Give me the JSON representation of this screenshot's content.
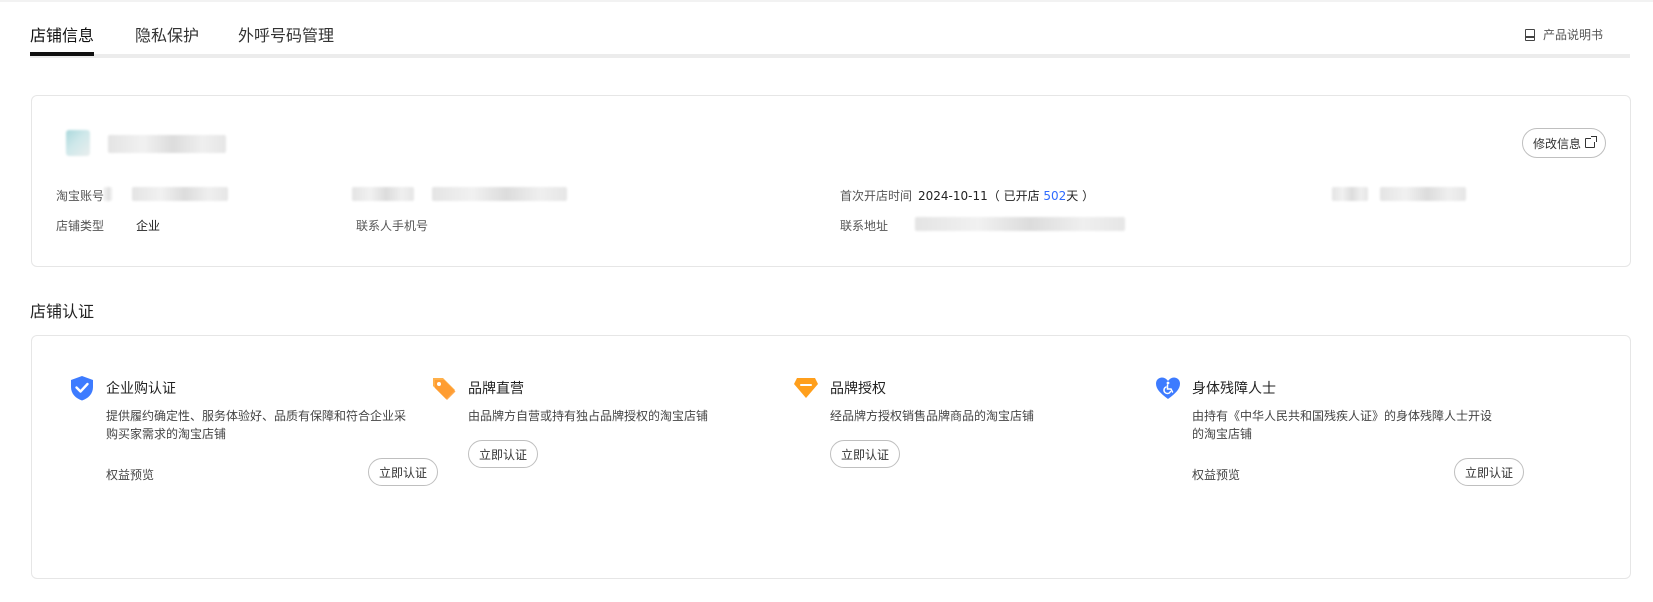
{
  "tabs": [
    {
      "label": "店铺信息",
      "active": true
    },
    {
      "label": "隐私保护",
      "active": false
    },
    {
      "label": "外呼号码管理",
      "active": false
    }
  ],
  "manual": {
    "label": "产品说明书",
    "icon": "book-icon"
  },
  "store_info": {
    "edit_label": "修改信息",
    "taobao_account_label": "淘宝账号",
    "shop_type_label": "店铺类型",
    "shop_type_value": "企业",
    "contact_phone_label": "联系人手机号",
    "first_open_label": "首次开店时间",
    "first_open_date": "2024-10-11",
    "open_days_prefix": "（ 已开店 ",
    "open_days": "502",
    "open_days_suffix": "天 ）",
    "address_label": "联系地址"
  },
  "certification": {
    "section_title": "店铺认证",
    "items": [
      {
        "title": "企业购认证",
        "desc": "提供履约确定性、服务体验好、品质有保障和符合企业采购买家需求的淘宝店铺",
        "benefit_label": "权益预览",
        "button_label": "立即认证",
        "icon": "shield-check-icon",
        "color": "#3d7bff"
      },
      {
        "title": "品牌直营",
        "desc": "由品牌方自营或持有独占品牌授权的淘宝店铺",
        "button_label": "立即认证",
        "icon": "price-tag-icon",
        "color": "#ff9a2e"
      },
      {
        "title": "品牌授权",
        "desc": "经品牌方授权销售品牌商品的淘宝店铺",
        "button_label": "立即认证",
        "icon": "diamond-icon",
        "color": "#ff9f1c"
      },
      {
        "title": "身体残障人士",
        "desc": "由持有《中华人民共和国残疾人证》的身体残障人士开设的淘宝店铺",
        "benefit_label": "权益预览",
        "button_label": "立即认证",
        "icon": "heart-accessibility-icon",
        "color": "#3d7bff"
      }
    ]
  }
}
